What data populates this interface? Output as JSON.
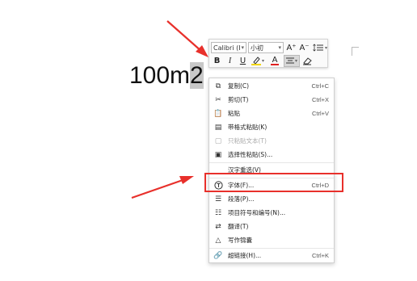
{
  "document": {
    "text_before": "100m",
    "text_selected": "2"
  },
  "mini_toolbar": {
    "font_name": "Calibri (I",
    "font_size": "小初",
    "grow_font": "A⁺",
    "shrink_font": "A⁻",
    "bold": "B",
    "italic": "I",
    "underline": "U",
    "font_color": "A"
  },
  "context_menu": {
    "items": [
      {
        "label": "复制(C)",
        "shortcut": "Ctrl+C",
        "icon": "copy-icon"
      },
      {
        "label": "剪切(T)",
        "shortcut": "Ctrl+X",
        "icon": "scissors-icon"
      },
      {
        "label": "粘贴",
        "shortcut": "Ctrl+V",
        "icon": "paste-icon"
      },
      {
        "label": "带格式粘贴(K)",
        "shortcut": "",
        "icon": "paste-format-icon"
      },
      {
        "label": "只粘贴文本(T)",
        "shortcut": "",
        "icon": "paste-text-icon",
        "disabled": true
      },
      {
        "label": "选择性粘贴(S)...",
        "shortcut": "",
        "icon": "paste-special-icon"
      },
      {
        "label": "汉字重选(V)",
        "shortcut": "",
        "icon": ""
      },
      {
        "label": "字体(F)...",
        "shortcut": "Ctrl+D",
        "icon": "font-icon"
      },
      {
        "label": "段落(P)...",
        "shortcut": "",
        "icon": "paragraph-icon"
      },
      {
        "label": "项目符号和编号(N)...",
        "shortcut": "",
        "icon": "list-icon"
      },
      {
        "label": "翻译(T)",
        "shortcut": "",
        "icon": "translate-icon"
      },
      {
        "label": "写作锦囊",
        "shortcut": "",
        "icon": "writing-icon"
      },
      {
        "label": "超链接(H)...",
        "shortcut": "Ctrl+K",
        "icon": "link-icon"
      }
    ]
  },
  "colors": {
    "highlight": "#e8302b",
    "arrow": "#e8302b",
    "selection": "#c8c8c8"
  }
}
